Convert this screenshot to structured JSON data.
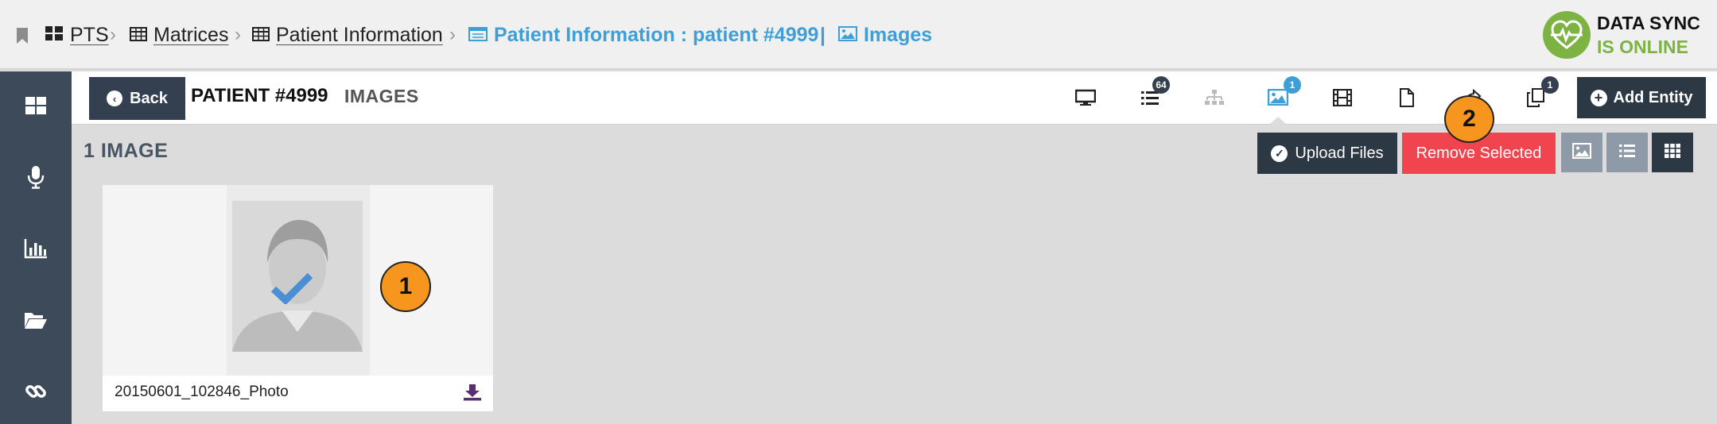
{
  "breadcrumbs": {
    "bookmark_icon": "bookmark-icon",
    "items": [
      {
        "label": "PTS",
        "icon": "dashboard-icon"
      },
      {
        "label": "Matrices",
        "icon": "table-icon"
      },
      {
        "label": "Patient Information",
        "icon": "table-icon"
      }
    ],
    "current": {
      "label": "Patient Information : patient #4999",
      "icon": "form-icon"
    },
    "separator": "|",
    "current_section": {
      "label": "Images",
      "icon": "image-icon"
    },
    "separator_char": "›"
  },
  "sync_status": {
    "line1": "DATA SYNC",
    "line2": "IS ONLINE",
    "color": "#7cb342"
  },
  "sidebar": {
    "items": [
      {
        "name": "dashboard",
        "icon": "dashboard-icon"
      },
      {
        "name": "voice",
        "icon": "microphone-icon"
      },
      {
        "name": "reports",
        "icon": "bar-chart-icon"
      },
      {
        "name": "files",
        "icon": "folder-open-icon"
      },
      {
        "name": "links",
        "icon": "link-icon"
      }
    ]
  },
  "header": {
    "back_label": "Back",
    "patient_title": "PATIENT #4999",
    "section_title": "IMAGES",
    "tools": [
      {
        "name": "desktop",
        "icon": "desktop-icon",
        "badge": ""
      },
      {
        "name": "list",
        "icon": "list-icon",
        "badge": "64"
      },
      {
        "name": "hierarchy",
        "icon": "sitemap-icon",
        "badge": ""
      },
      {
        "name": "images",
        "icon": "image-icon",
        "badge": "1",
        "active": true
      },
      {
        "name": "video",
        "icon": "film-icon",
        "badge": ""
      },
      {
        "name": "documents",
        "icon": "file-icon",
        "badge": ""
      },
      {
        "name": "share",
        "icon": "share-icon",
        "badge": ""
      },
      {
        "name": "copies",
        "icon": "copy-icon",
        "badge": "1"
      }
    ],
    "add_entity_label": "Add Entity"
  },
  "content": {
    "count_title": "1 IMAGE",
    "upload_label": "Upload Files",
    "remove_label": "Remove Selected",
    "views": [
      {
        "name": "thumbnail",
        "icon": "image-icon",
        "active": false
      },
      {
        "name": "list",
        "icon": "list-icon",
        "active": false
      },
      {
        "name": "grid",
        "icon": "grid-icon",
        "active": true
      }
    ],
    "images": [
      {
        "filename": "20150601_102846_Photo",
        "selected": true
      }
    ]
  },
  "callouts": [
    "1",
    "2"
  ],
  "colors": {
    "accent_blue": "#3e9fd6",
    "dark": "#2d3845",
    "danger": "#f0454e",
    "callout": "#f7961e"
  }
}
